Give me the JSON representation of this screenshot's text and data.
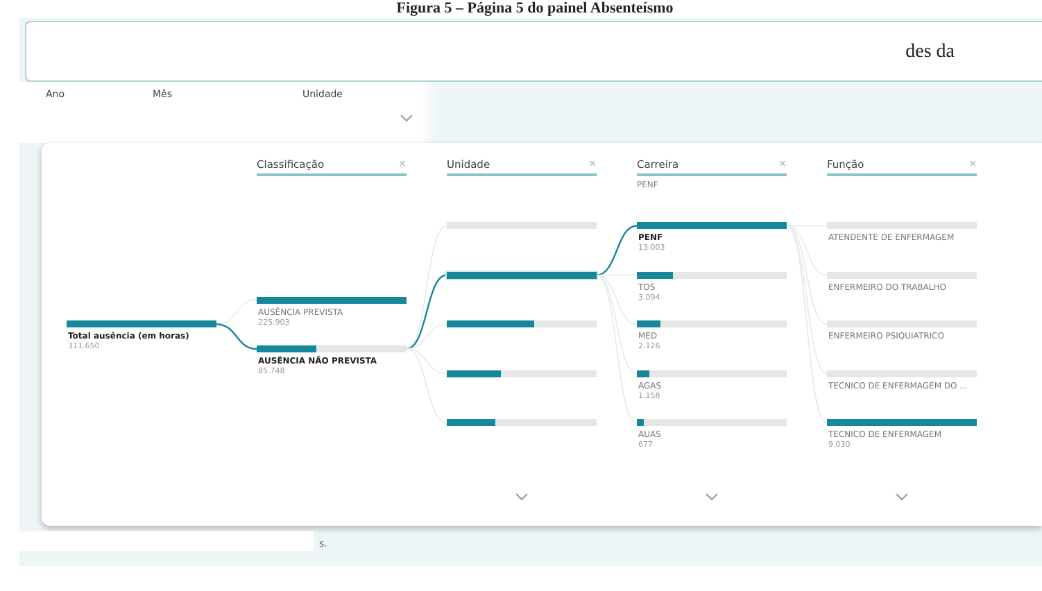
{
  "caption": "Figura 5 – Página 5 do painel Absenteísmo",
  "top_card": {
    "text": "des da"
  },
  "slicers": [
    {
      "label": "Ano",
      "dropdown": false
    },
    {
      "label": "Mês",
      "dropdown": false
    },
    {
      "label": "Unidade",
      "dropdown": true
    }
  ],
  "tree": {
    "columns": [
      {
        "nodes": [
          {
            "label": "Total ausência (em horas)",
            "value": "311.650",
            "level": 1,
            "selected": true
          }
        ]
      },
      {
        "header": "Classificação",
        "close": "×",
        "nodes": [
          {
            "label": "AUSÊNCIA PREVISTA",
            "value": "225.903",
            "level": 1,
            "selected": false
          },
          {
            "label": "AUSÊNCIA NÃO PREVISTA",
            "value": "85.748",
            "level": 0.4,
            "selected": true
          }
        ]
      },
      {
        "header": "Unidade",
        "close": "×",
        "nodes": [
          {
            "level": 0,
            "selected": false
          },
          {
            "level": 1,
            "selected": true
          },
          {
            "level": 0.58,
            "selected": false
          },
          {
            "level": 0.36,
            "selected": false
          },
          {
            "level": 0.32,
            "selected": false
          }
        ],
        "more": true
      },
      {
        "header": "Carreira",
        "close": "×",
        "subtitle": "PENF",
        "nodes": [
          {
            "label": "PENF",
            "value": "13.003",
            "level": 1,
            "selected": true
          },
          {
            "label": "TOS",
            "value": "3.094",
            "level": 0.24,
            "selected": false
          },
          {
            "label": "MED",
            "value": "2.126",
            "level": 0.16,
            "selected": false
          },
          {
            "label": "AGAS",
            "value": "1.158",
            "level": 0.08,
            "selected": false
          },
          {
            "label": "AUAS",
            "value": "677",
            "level": 0.05,
            "selected": false
          }
        ],
        "more": true
      },
      {
        "header": "Função",
        "close": "×",
        "nodes": [
          {
            "label": "ATENDENTE DE ENFERMAGEM",
            "level": 0,
            "selected": false
          },
          {
            "label": "ENFERMEIRO DO TRABALHO",
            "level": 0,
            "selected": false
          },
          {
            "label": "ENFERMEIRO PSIQUIATRICO",
            "level": 0,
            "selected": false
          },
          {
            "label": "TECNICO DE ENFERMAGEM DO ...",
            "level": 0,
            "selected": false
          },
          {
            "label": "TECNICO DE ENFERMAGEM",
            "value": "9.030",
            "level": 1,
            "selected": false
          }
        ],
        "more": true
      }
    ]
  },
  "footer_text": "s."
}
